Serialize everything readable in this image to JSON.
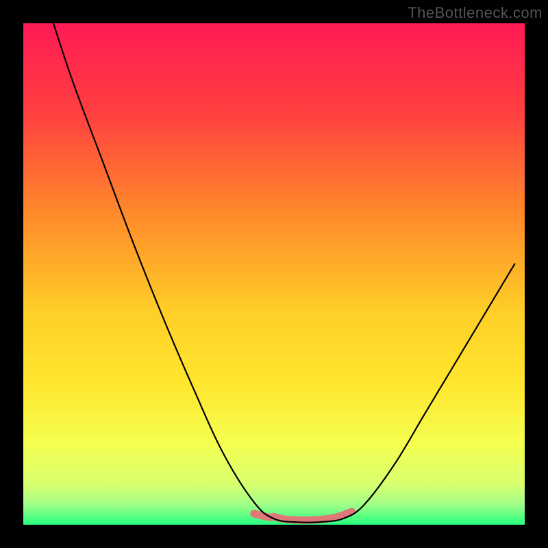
{
  "watermark": "TheBottleneck.com",
  "chart_data": {
    "type": "line",
    "title": "",
    "xlabel": "",
    "ylabel": "",
    "xlim": [
      0,
      100
    ],
    "ylim": [
      0,
      100
    ],
    "gradient_colors": {
      "top": "#ff1a55",
      "upper_mid": "#ff8a2a",
      "mid": "#ffe62e",
      "lower_mid": "#e8ff55",
      "bottom_band": "#28ff80"
    },
    "series": [
      {
        "name": "curve",
        "color": "#000000",
        "stroke_width": 2.2,
        "points": [
          {
            "x": 6,
            "y": 100
          },
          {
            "x": 10,
            "y": 88
          },
          {
            "x": 16,
            "y": 72
          },
          {
            "x": 22,
            "y": 56
          },
          {
            "x": 28,
            "y": 41
          },
          {
            "x": 34,
            "y": 27
          },
          {
            "x": 40,
            "y": 14
          },
          {
            "x": 46,
            "y": 4.5
          },
          {
            "x": 50,
            "y": 1.2
          },
          {
            "x": 55,
            "y": 0.5
          },
          {
            "x": 60,
            "y": 0.6
          },
          {
            "x": 64,
            "y": 1.3
          },
          {
            "x": 68,
            "y": 4
          },
          {
            "x": 74,
            "y": 12
          },
          {
            "x": 80,
            "y": 22
          },
          {
            "x": 86,
            "y": 32
          },
          {
            "x": 92,
            "y": 42
          },
          {
            "x": 98,
            "y": 52
          }
        ]
      },
      {
        "name": "bottom-highlight",
        "color": "#e07878",
        "stroke_width": 11,
        "points": [
          {
            "x": 46,
            "y": 2.2
          },
          {
            "x": 49,
            "y": 1.5
          },
          {
            "x": 50,
            "y": 1.6
          },
          {
            "x": 51,
            "y": 1.3
          },
          {
            "x": 53,
            "y": 1.0
          },
          {
            "x": 56,
            "y": 0.9
          },
          {
            "x": 59,
            "y": 1.0
          },
          {
            "x": 62,
            "y": 1.4
          },
          {
            "x": 64,
            "y": 2.0
          },
          {
            "x": 65.5,
            "y": 2.6
          }
        ]
      }
    ]
  }
}
